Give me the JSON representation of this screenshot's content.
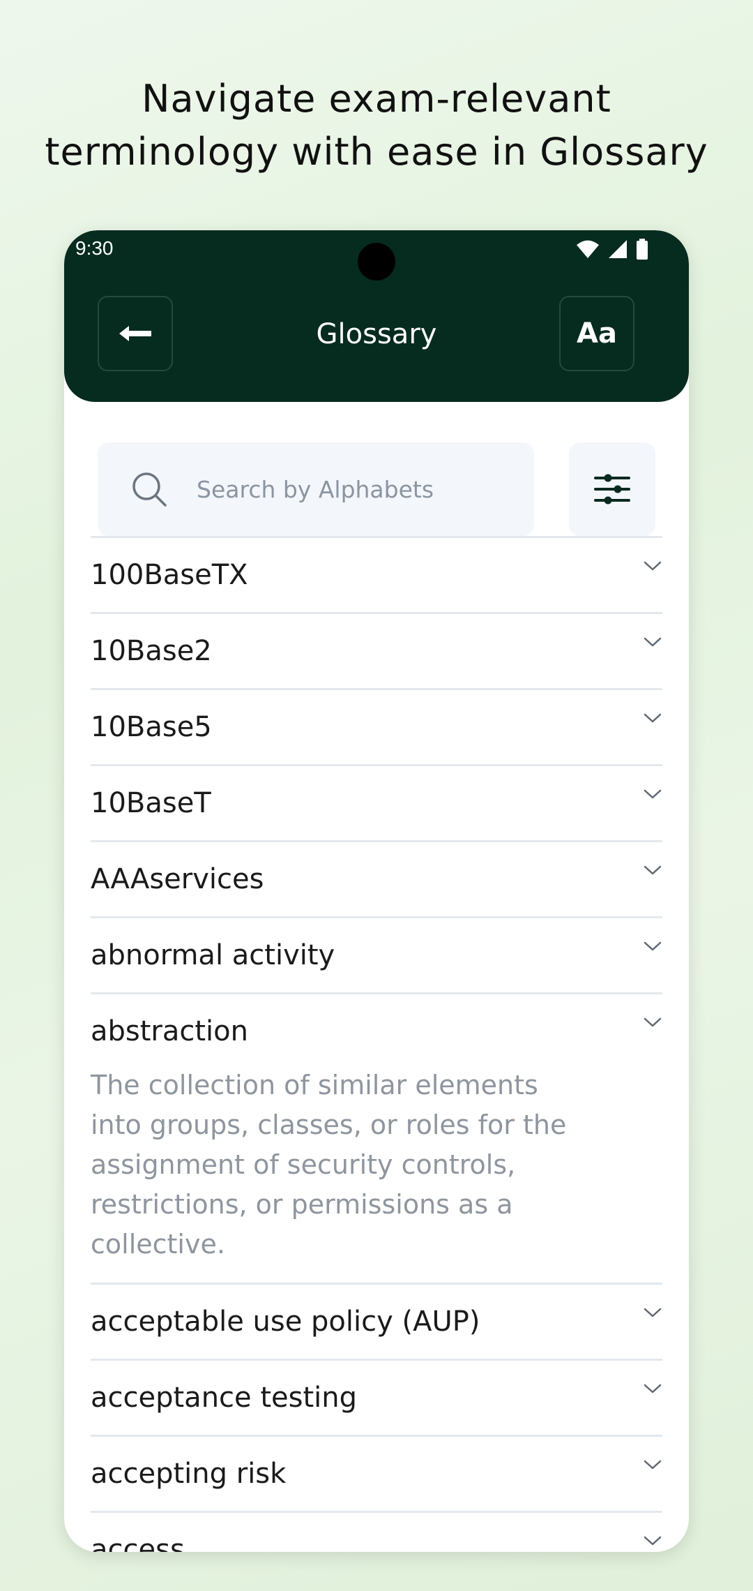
{
  "headline": {
    "line1": "Navigate exam-relevant",
    "line2": "terminology with ease in Glossary"
  },
  "status_bar": {
    "time": "9:30",
    "icons": [
      "wifi-icon",
      "signal-icon",
      "battery-icon"
    ]
  },
  "app_bar": {
    "title": "Glossary",
    "back_icon": "arrow-left-icon",
    "font_button_label": "Aa",
    "background_color": "#062b1f"
  },
  "search": {
    "placeholder": "Search by Alphabets",
    "value": "",
    "icon": "search-icon",
    "filter_icon": "sliders-icon"
  },
  "glossary": {
    "items": [
      {
        "term": "100BaseTX",
        "expanded": false
      },
      {
        "term": "10Base2",
        "expanded": false
      },
      {
        "term": "10Base5",
        "expanded": false
      },
      {
        "term": "10BaseT",
        "expanded": false
      },
      {
        "term": "AAAservices",
        "expanded": false
      },
      {
        "term": "abnormal activity",
        "expanded": false
      },
      {
        "term": "abstraction",
        "expanded": true,
        "definition": "The collection of similar elements into groups, classes, or roles for the assignment of security controls, restrictions, or permissions as a collective."
      },
      {
        "term": "acceptable use policy (AUP)",
        "expanded": false
      },
      {
        "term": "acceptance testing",
        "expanded": false
      },
      {
        "term": "accepting risk",
        "expanded": false
      },
      {
        "term": "access",
        "expanded": false
      }
    ]
  }
}
